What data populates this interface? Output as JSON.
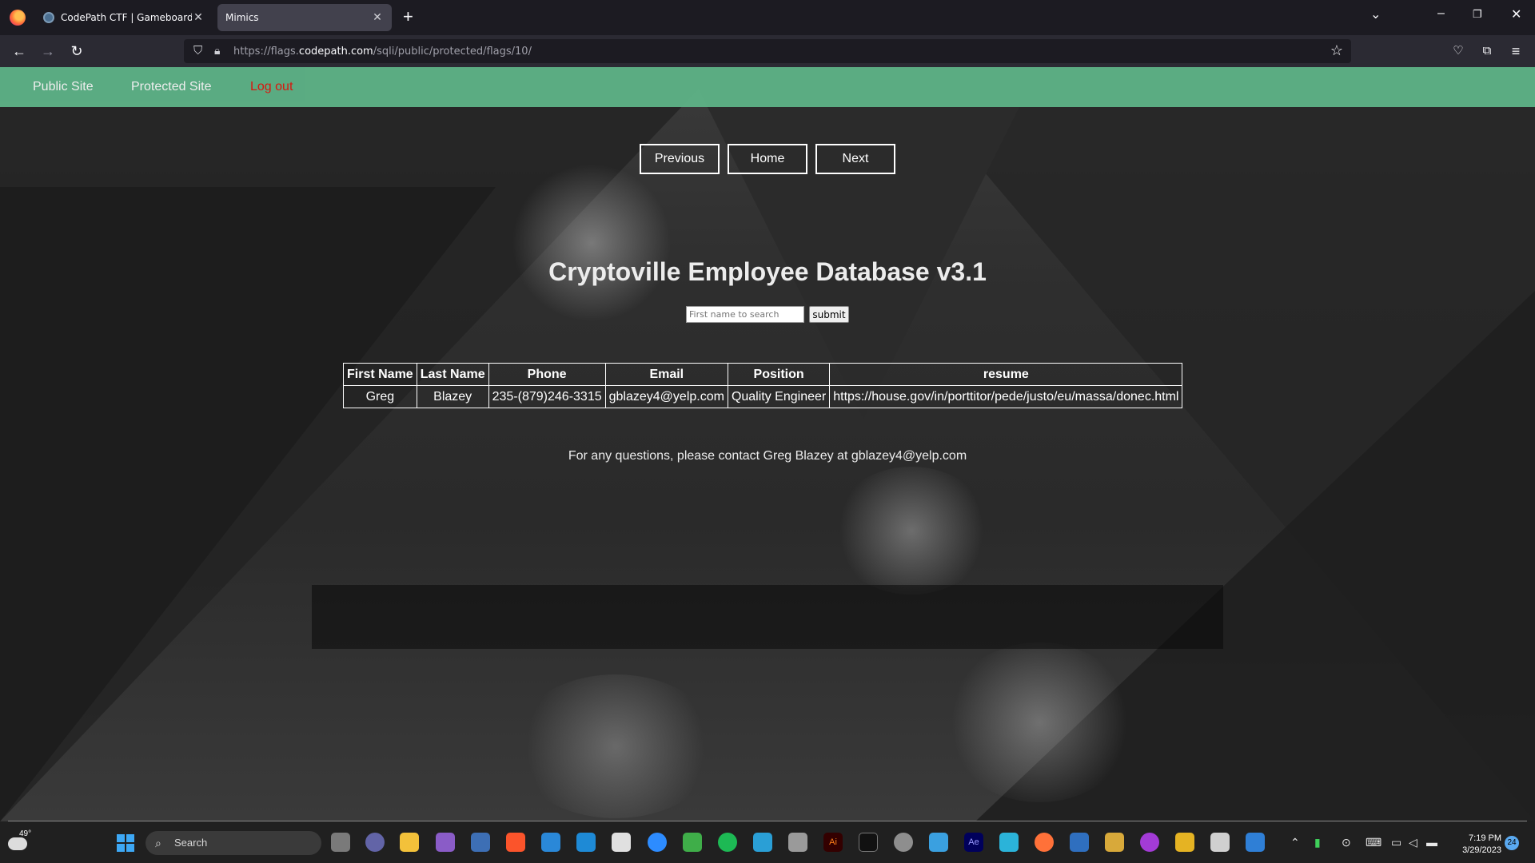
{
  "browser": {
    "tabs": [
      {
        "title": "CodePath CTF | Gameboard",
        "active": false
      },
      {
        "title": "Mimics",
        "active": true
      }
    ],
    "url_prefix": "https://flags.",
    "url_domain": "codepath.com",
    "url_path": "/sqli/public/protected/flags/10/"
  },
  "site_nav": {
    "public_label": "Public Site",
    "protected_label": "Protected Site",
    "logout_label": "Log out"
  },
  "pager": {
    "previous_label": "Previous",
    "home_label": "Home",
    "next_label": "Next"
  },
  "heading": "Cryptoville Employee Database v3.1",
  "search": {
    "placeholder": "First name to search",
    "submit_label": "submit"
  },
  "table": {
    "headers": [
      "First Name",
      "Last Name",
      "Phone",
      "Email",
      "Position",
      "resume"
    ],
    "rows": [
      [
        "Greg",
        "Blazey",
        "235-(879)246-3315",
        "gblazey4@yelp.com",
        "Quality Engineer",
        "https://house.gov/in/porttitor/pede/justo/eu/massa/donec.html"
      ]
    ]
  },
  "contact": "For any questions, please contact Greg Blazey at gblazey4@yelp.com",
  "taskbar": {
    "temperature": "49°",
    "search_label": "Search",
    "time": "7:19 PM",
    "date": "3/29/2023",
    "notification_count": "24"
  },
  "colors": {
    "site_nav_bg": "#5fb78a",
    "logout": "#e8160c",
    "browser_bg": "#1c1b22"
  }
}
